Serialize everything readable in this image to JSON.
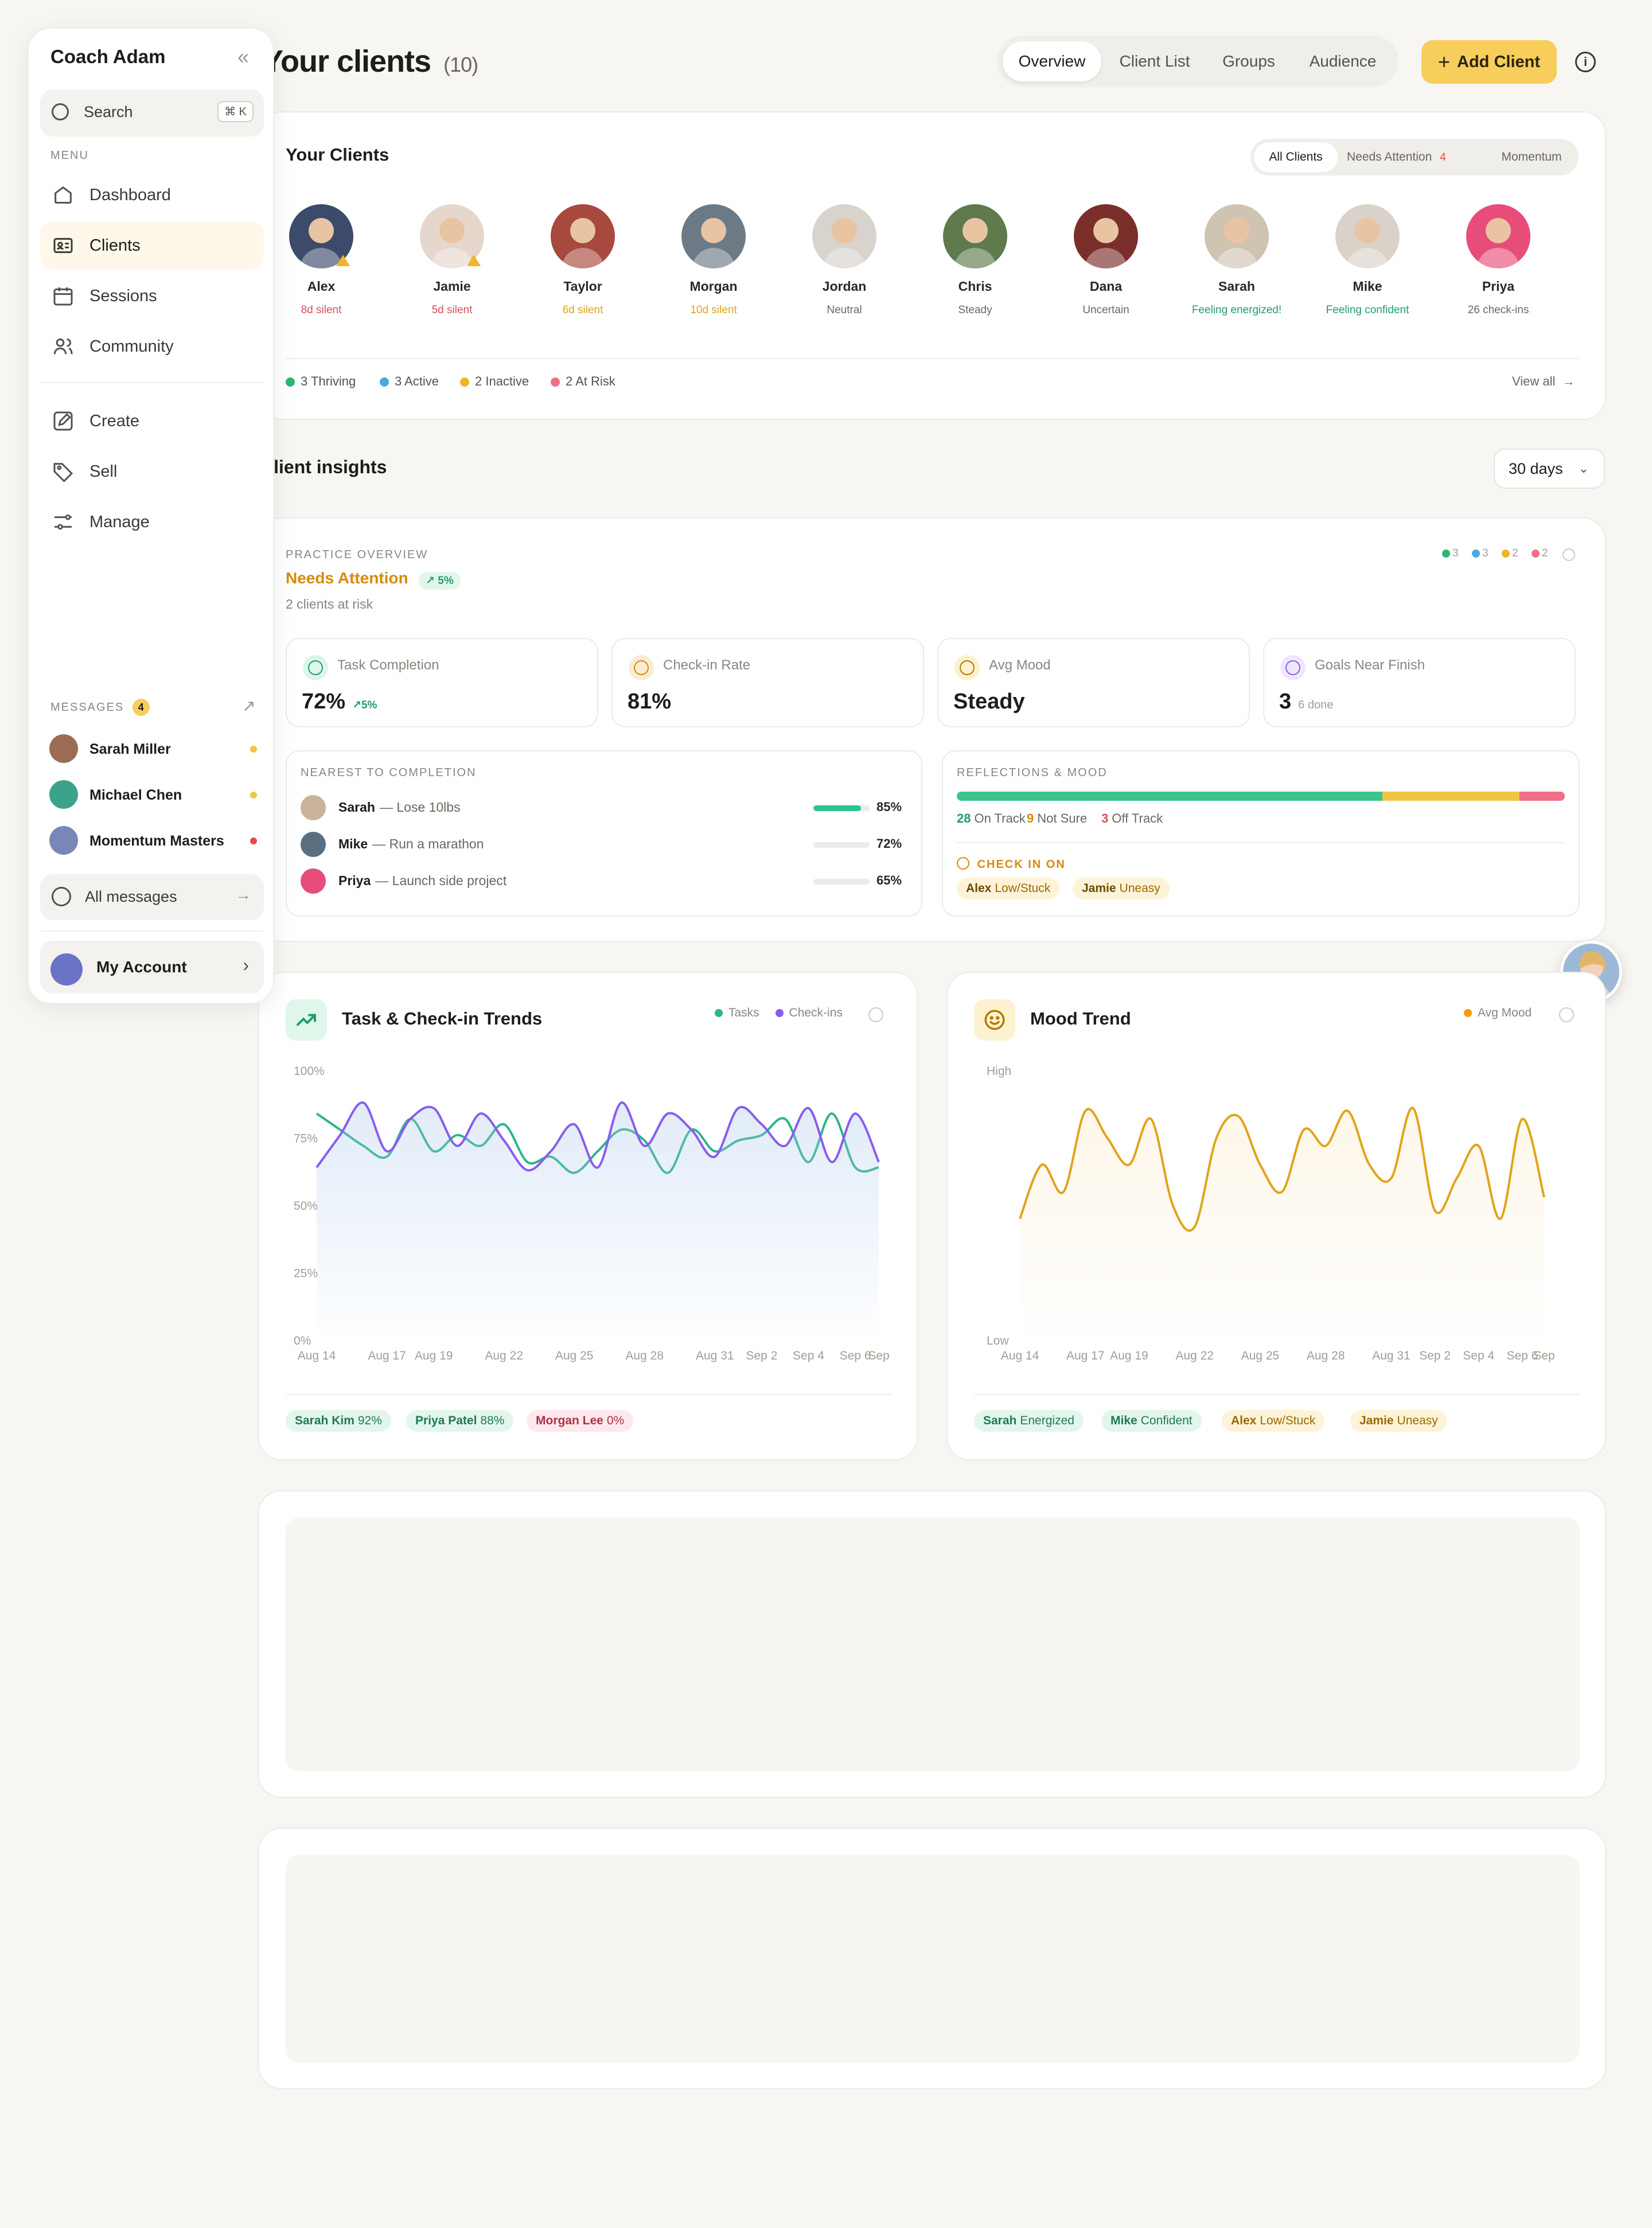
{
  "sidebar": {
    "title": "Coach Adam",
    "search": {
      "label": "Search",
      "shortcut": "⌘ K"
    },
    "menu_heading": "MENU",
    "menu": [
      {
        "label": "Dashboard",
        "icon": "home-icon"
      },
      {
        "label": "Clients",
        "icon": "id-card-icon",
        "active": true
      },
      {
        "label": "Sessions",
        "icon": "calendar-icon"
      },
      {
        "label": "Community",
        "icon": "users-icon"
      },
      {
        "label": "Create",
        "icon": "edit-icon"
      },
      {
        "label": "Sell",
        "icon": "tag-icon"
      },
      {
        "label": "Manage",
        "icon": "sliders-icon"
      }
    ],
    "messages_heading": "MESSAGES",
    "messages_count": "4",
    "messages": [
      {
        "name": "Sarah Miller",
        "dot": "#f0c545"
      },
      {
        "name": "Michael Chen",
        "dot": "#f0c545"
      },
      {
        "name": "Momentum Masters",
        "dot": "#e5484d"
      }
    ],
    "all_messages": "All messages",
    "account": "My Account"
  },
  "header": {
    "title": "Your clients",
    "count": "(10)",
    "tabs": [
      "Overview",
      "Client List",
      "Groups",
      "Audience"
    ],
    "add_client": "Add Client"
  },
  "clients_card": {
    "title": "Your Clients",
    "filters": [
      {
        "label": "All Clients",
        "badge": ""
      },
      {
        "label": "Needs Attention",
        "badge": "4"
      },
      {
        "label": "Momentum",
        "badge": ""
      }
    ],
    "clients": [
      {
        "name": "Alex",
        "status": "8d silent",
        "color": "#d94f5c",
        "bg": "#3c4a6b",
        "warn": true
      },
      {
        "name": "Jamie",
        "status": "5d silent",
        "color": "#d94f5c",
        "bg": "#e6d7cd",
        "warn": true
      },
      {
        "name": "Taylor",
        "status": "6d silent",
        "color": "#e0a41c",
        "bg": "#a8493d",
        "warn": false
      },
      {
        "name": "Morgan",
        "status": "10d silent",
        "color": "#e0a41c",
        "bg": "#6c7a86",
        "warn": false
      },
      {
        "name": "Jordan",
        "status": "Neutral",
        "color": "#6b675f",
        "bg": "#d8d3cc",
        "warn": false
      },
      {
        "name": "Chris",
        "status": "Steady",
        "color": "#6b675f",
        "bg": "#5f7a4c",
        "warn": false
      },
      {
        "name": "Dana",
        "status": "Uncertain",
        "color": "#6b675f",
        "bg": "#7a2f2a",
        "warn": false
      },
      {
        "name": "Sarah",
        "status": "Feeling energized!",
        "color": "#1f9d6b",
        "bg": "#cfc3b1",
        "warn": false
      },
      {
        "name": "Mike",
        "status": "Feeling confident",
        "color": "#1f9d6b",
        "bg": "#d9d2c8",
        "warn": false
      },
      {
        "name": "Priya",
        "status": "26 check-ins",
        "color": "#6b675f",
        "bg": "#e84d7a",
        "warn": false
      }
    ],
    "legend": [
      {
        "label": "3 Thriving",
        "color": "#2bb673"
      },
      {
        "label": "3 Active",
        "color": "#4aa8e0"
      },
      {
        "label": "2 Inactive",
        "color": "#f0b429"
      },
      {
        "label": "2 At Risk",
        "color": "#ef6f86"
      }
    ],
    "view_all": "View all"
  },
  "insights": {
    "title": "Client insights",
    "range": "30 days",
    "overview_label": "PRACTICE OVERVIEW",
    "status": "Needs Attention",
    "status_change": "5%",
    "status_sub": "2 clients at risk",
    "top_dots": [
      {
        "n": "3",
        "color": "#2bb673"
      },
      {
        "n": "3",
        "color": "#4aa8e0"
      },
      {
        "n": "2",
        "color": "#f0b429"
      },
      {
        "n": "2",
        "color": "#ef6f86"
      }
    ],
    "kpis": [
      {
        "label": "Task Completion",
        "value": "72%",
        "extra": "5%",
        "icon": "check-circle-icon"
      },
      {
        "label": "Check-in Rate",
        "value": "81%",
        "extra": "",
        "icon": "calendar-icon"
      },
      {
        "label": "Avg Mood",
        "value": "Steady",
        "extra": "",
        "icon": "smile-icon"
      },
      {
        "label": "Goals Near Finish",
        "value": "3",
        "extra": "6 done",
        "icon": "trophy-icon"
      }
    ],
    "nearest_label": "NEAREST TO COMPLETION",
    "goals": [
      {
        "name": "Sarah",
        "goal": "— Lose 10lbs",
        "pct": 85,
        "pct_label": "85%"
      },
      {
        "name": "Mike",
        "goal": "— Run a marathon",
        "pct": 72,
        "pct_label": "72%"
      },
      {
        "name": "Priya",
        "goal": "— Launch side project",
        "pct": 65,
        "pct_label": "65%"
      }
    ],
    "reflections_label": "REFLECTIONS & MOOD",
    "mood_split": [
      {
        "n": "28",
        "label": "On Track",
        "color": "#3cc48f"
      },
      {
        "n": "9",
        "label": "Not Sure",
        "color": "#f0c545"
      },
      {
        "n": "3",
        "label": "Off Track",
        "color": "#ef6f86"
      }
    ],
    "check_in_label": "CHECK IN ON",
    "check_in": [
      {
        "name": "Alex",
        "state": "Low/Stuck"
      },
      {
        "name": "Jamie",
        "state": "Uneasy"
      }
    ]
  },
  "trends": {
    "title": "Task & Check-in Trends",
    "legend": [
      "Tasks",
      "Check-ins"
    ],
    "pills": [
      {
        "name": "Sarah Kim",
        "val": "92%",
        "fg": "#1f7a55",
        "bg": "#e3f6ec"
      },
      {
        "name": "Priya Patel",
        "val": "88%",
        "fg": "#1f7a55",
        "bg": "#e3f6ec"
      },
      {
        "name": "Morgan Lee",
        "val": "0%",
        "fg": "#b0304a",
        "bg": "#fde8ec"
      }
    ]
  },
  "mood": {
    "title": "Mood Trend",
    "legend": "Avg Mood",
    "pills": [
      {
        "name": "Sarah",
        "val": "Energized",
        "fg": "#1f7a55",
        "bg": "#e3f6ec"
      },
      {
        "name": "Mike",
        "val": "Confident",
        "fg": "#1f7a55",
        "bg": "#e3f6ec"
      },
      {
        "name": "Alex",
        "val": "Low/Stuck",
        "fg": "#9a6a00",
        "bg": "#fdf3d8"
      },
      {
        "name": "Jamie",
        "val": "Uneasy",
        "fg": "#9a6a00",
        "bg": "#fdf3d8"
      }
    ]
  },
  "chart_data": [
    {
      "type": "line",
      "title": "Task & Check-in Trends",
      "x": [
        "Aug 14",
        "Aug 15",
        "Aug 16",
        "Aug 17",
        "Aug 18",
        "Aug 19",
        "Aug 20",
        "Aug 21",
        "Aug 22",
        "Aug 23",
        "Aug 24",
        "Aug 25",
        "Aug 26",
        "Aug 27",
        "Aug 28",
        "Aug 29",
        "Aug 30",
        "Aug 31",
        "Sep 1",
        "Sep 2",
        "Sep 3",
        "Sep 4",
        "Sep 5",
        "Sep 6",
        "Sep 7"
      ],
      "x_ticks": [
        "Aug 14",
        "Aug 17",
        "Aug 19",
        "Aug 22",
        "Aug 25",
        "Aug 28",
        "Aug 31",
        "Sep 2",
        "Sep 4",
        "Sep 6",
        "Sep"
      ],
      "y_ticks": [
        "100%",
        "75%",
        "50%",
        "25%",
        "0%"
      ],
      "ylim": [
        0,
        100
      ],
      "series": [
        {
          "name": "Tasks",
          "color": "#2bb58a",
          "values": [
            84,
            78,
            72,
            68,
            82,
            70,
            76,
            72,
            80,
            66,
            68,
            62,
            70,
            78,
            74,
            62,
            78,
            70,
            74,
            76,
            82,
            66,
            84,
            64,
            64
          ]
        },
        {
          "name": "Check-ins",
          "color": "#8a5cf0",
          "values": [
            64,
            76,
            88,
            70,
            82,
            86,
            72,
            84,
            74,
            63,
            70,
            80,
            64,
            88,
            72,
            84,
            78,
            68,
            86,
            80,
            72,
            86,
            66,
            84,
            66
          ]
        }
      ]
    },
    {
      "type": "area",
      "title": "Mood Trend",
      "x": [
        "Aug 14",
        "Aug 15",
        "Aug 16",
        "Aug 17",
        "Aug 18",
        "Aug 19",
        "Aug 20",
        "Aug 21",
        "Aug 22",
        "Aug 23",
        "Aug 24",
        "Aug 25",
        "Aug 26",
        "Aug 27",
        "Aug 28",
        "Aug 29",
        "Aug 30",
        "Aug 31",
        "Sep 1",
        "Sep 2",
        "Sep 3",
        "Sep 4",
        "Sep 5",
        "Sep 6",
        "Sep 7"
      ],
      "x_ticks": [
        "Aug 14",
        "Aug 17",
        "Aug 19",
        "Aug 22",
        "Aug 25",
        "Aug 28",
        "Aug 31",
        "Sep 2",
        "Sep 4",
        "Sep 6",
        "Sep"
      ],
      "y_ticks": [
        "High",
        "Low"
      ],
      "ylim": [
        0,
        10
      ],
      "series": [
        {
          "name": "Avg Mood",
          "color": "#e0a41c",
          "values": [
            4.5,
            6.5,
            5.5,
            8.5,
            7.5,
            6.5,
            8.2,
            5.0,
            4.2,
            7.5,
            8.3,
            6.5,
            5.5,
            7.8,
            7.2,
            8.5,
            6.5,
            6.0,
            8.6,
            4.8,
            6.0,
            7.2,
            4.5,
            8.2,
            5.3
          ]
        }
      ]
    }
  ]
}
